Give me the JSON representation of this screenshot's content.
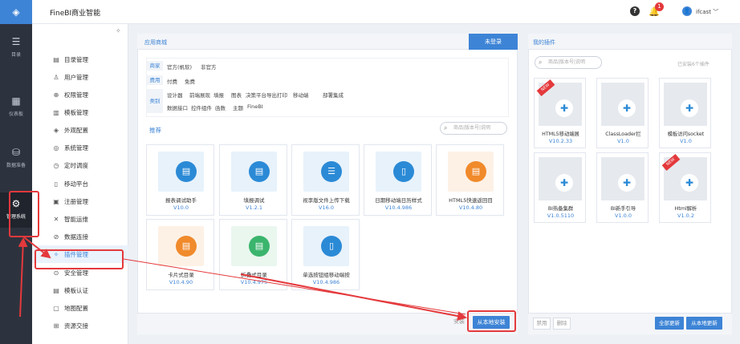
{
  "app": {
    "title": "FineBI商业智能",
    "logo_icon": "diamond-logo-icon",
    "user": "ifcast",
    "notification_count": "1"
  },
  "rail": [
    {
      "icon": "list-icon",
      "label": "目录"
    },
    {
      "icon": "grid-icon",
      "label": "仪表板"
    },
    {
      "icon": "database-icon",
      "label": "数据准备"
    },
    {
      "icon": "gear-icon",
      "label": "管理系统",
      "active": true
    }
  ],
  "menu": [
    {
      "icon": "catalog-icon",
      "label": "目录管理"
    },
    {
      "icon": "user-icon",
      "label": "用户管理"
    },
    {
      "icon": "lock-icon",
      "label": "权限管理"
    },
    {
      "icon": "template-icon",
      "label": "模板管理"
    },
    {
      "icon": "palette-icon",
      "label": "外观配置"
    },
    {
      "icon": "settings-icon",
      "label": "系统管理"
    },
    {
      "icon": "clock-icon",
      "label": "定时调度"
    },
    {
      "icon": "mobile-icon",
      "label": "移动平台"
    },
    {
      "icon": "register-icon",
      "label": "注册管理"
    },
    {
      "icon": "ops-icon",
      "label": "智能运维"
    },
    {
      "icon": "link-icon",
      "label": "数据连接"
    },
    {
      "icon": "plugin-icon",
      "label": "插件管理",
      "active": true
    },
    {
      "icon": "shield-icon",
      "label": "安全管理"
    },
    {
      "icon": "cert-icon",
      "label": "模板认证"
    },
    {
      "icon": "map-icon",
      "label": "地图配置"
    },
    {
      "icon": "exchange-icon",
      "label": "资源交接"
    }
  ],
  "store": {
    "title": "应用商城",
    "login_button": "未登录",
    "filters": {
      "merchant": {
        "label": "商家",
        "options": [
          "官方(帆软)",
          "非官方"
        ]
      },
      "price": {
        "label": "费用",
        "options": [
          "付费",
          "免费"
        ]
      },
      "category": {
        "label": "类别",
        "row1": [
          "设计器",
          "前端展现",
          "填报",
          "图表",
          "决策平台",
          "导出打印",
          "移动端",
          "部署集成"
        ],
        "row2": [
          "数据接口",
          "控件组件",
          "函数",
          "主题",
          "FineBI"
        ]
      }
    },
    "recommend_label": "推荐",
    "search_placeholder": "商品|版本号|说明",
    "plugins": [
      {
        "name": "报表调试助手",
        "version": "V10.0",
        "color": "#2b8ad6"
      },
      {
        "name": "填报调试",
        "version": "V1.2.1",
        "color": "#2b8ad6"
      },
      {
        "name": "视李版文件上传下载",
        "version": "V16.0",
        "color": "#2b8ad6"
      },
      {
        "name": "日期移动端日历样式",
        "version": "V10.4.986",
        "color": "#2b8ad6"
      },
      {
        "name": "HTML5快速返回目",
        "version": "V10.4.80",
        "color": "#f08a2b"
      },
      {
        "name": "卡片式目录",
        "version": "V10.4.90",
        "color": "#f08a2b"
      },
      {
        "name": "折叠式目录",
        "version": "V10.4.975",
        "color": "#3bb56d"
      },
      {
        "name": "单选按钮组移动端按",
        "version": "V10.4.986",
        "color": "#2b8ad6"
      }
    ],
    "install_label": "安装",
    "local_install_label": "从本地安装"
  },
  "mine": {
    "title": "我的插件",
    "search_placeholder": "商品|版本号|说明",
    "count_text": "已安装6个插件",
    "new_tag": "NEW",
    "plugins": [
      {
        "name": "HTML5移动端展",
        "version": "V10.2.33",
        "new": true
      },
      {
        "name": "ClassLoader拦",
        "version": "V1.0",
        "new": false
      },
      {
        "name": "模板访问socket",
        "version": "V1.0",
        "new": false
      },
      {
        "name": "BI热备集群",
        "version": "V1.0.5110",
        "new": false
      },
      {
        "name": "BI新手引导",
        "version": "V1.0.0",
        "new": false
      },
      {
        "name": "Html解析",
        "version": "V1.0.2",
        "new": true
      }
    ],
    "disable_label": "禁用",
    "delete_label": "删除",
    "update_all_label": "全部更新",
    "local_update_label": "从本地更新"
  },
  "colors": {
    "accent": "#3d84d6",
    "highlight": "#e4393c",
    "rail": "#2d333e"
  }
}
